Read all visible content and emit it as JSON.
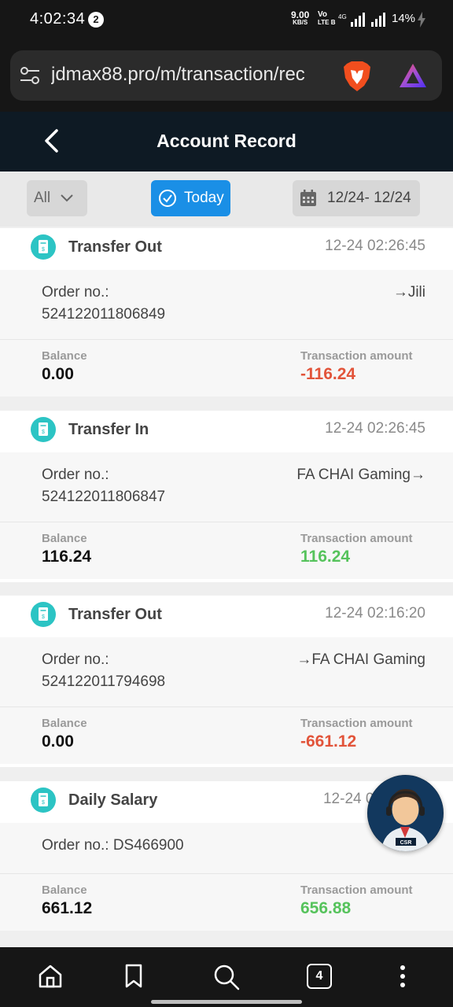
{
  "status_bar": {
    "time": "4:02:34",
    "notification_count": "2",
    "net_speed": "9.00",
    "net_unit": "KB/S",
    "volte_top": "Vo",
    "volte_bottom": "LTE B",
    "network_type": "4G",
    "battery": "14%"
  },
  "browser": {
    "url": "jdmax88.pro/m/transaction/rec",
    "tab_count": "4"
  },
  "header": {
    "title": "Account Record"
  },
  "filters": {
    "type_selected": "All",
    "today_label": "Today",
    "date_range": "12/24- 12/24"
  },
  "records": [
    {
      "type": "Transfer Out",
      "time": "12-24 02:26:45",
      "order_label": "Order no.:",
      "order_no": "524122011806849",
      "destination": "→Jili",
      "balance_label": "Balance",
      "balance": "0.00",
      "amount_label": "Transaction amount",
      "amount": "-116.24"
    },
    {
      "type": "Transfer In",
      "time": "12-24 02:26:45",
      "order_label": "Order no.:",
      "order_no": "524122011806847",
      "destination": "FA CHAI Gaming→",
      "balance_label": "Balance",
      "balance": "116.24",
      "amount_label": "Transaction amount",
      "amount": "116.24"
    },
    {
      "type": "Transfer Out",
      "time": "12-24 02:16:20",
      "order_label": "Order no.:",
      "order_no": "524122011794698",
      "destination": "→FA CHAI Gaming",
      "balance_label": "Balance",
      "balance": "0.00",
      "amount_label": "Transaction amount",
      "amount": "-661.12"
    },
    {
      "type": "Daily Salary",
      "time": "12-24 02",
      "order_label": "Order no.: DS466900",
      "order_no": "",
      "destination": "",
      "balance_label": "Balance",
      "balance": "661.12",
      "amount_label": "Transaction amount",
      "amount": "656.88"
    }
  ],
  "support_badge": "CSR",
  "colors": {
    "header_bg": "#0e1a24",
    "accent": "#1a8fe6",
    "negative": "#e2543a",
    "positive": "#56c35c"
  },
  "icons": {
    "record": "receipt-icon",
    "back": "chevron-left-icon",
    "calendar": "calendar-icon",
    "today": "check-circle-icon"
  }
}
